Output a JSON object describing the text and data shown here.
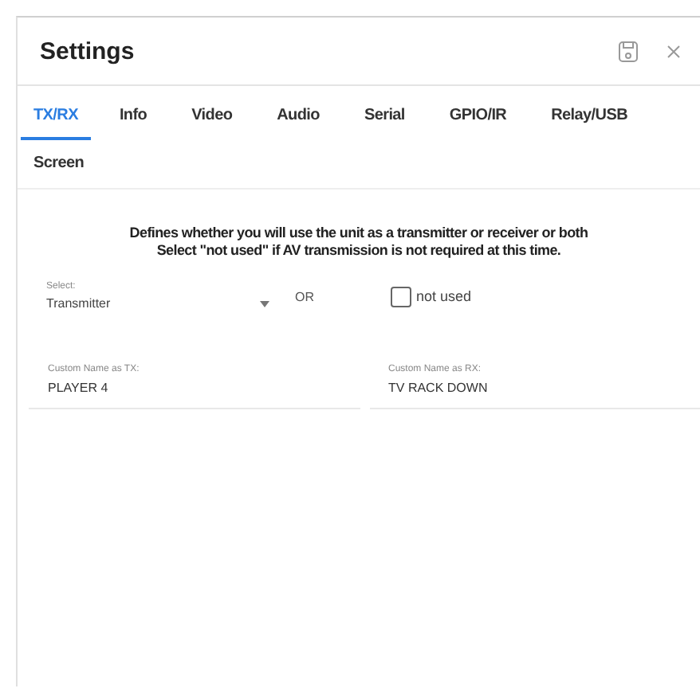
{
  "window": {
    "title": "Settings"
  },
  "tabs": [
    {
      "label": "TX/RX",
      "selected": true
    },
    {
      "label": "Info",
      "selected": false
    },
    {
      "label": "Video",
      "selected": false
    },
    {
      "label": "Audio",
      "selected": false
    },
    {
      "label": "Serial",
      "selected": false
    },
    {
      "label": "GPIO/IR",
      "selected": false
    },
    {
      "label": "Relay/USB",
      "selected": false
    },
    {
      "label": "Screen",
      "selected": false
    }
  ],
  "description": [
    "Defines whether you will use the unit as a transmitter or receiver or both",
    "Select \"not used\" if AV transmission is not required at this time."
  ],
  "select": {
    "label": "Select:",
    "value": "Transmitter"
  },
  "or_label": "OR",
  "not_used": {
    "label": "not used",
    "checked": false
  },
  "fields": [
    {
      "label": "Custom Name as TX:",
      "value": "PLAYER 4"
    },
    {
      "label": "Custom Name as RX:",
      "value": "TV RACK DOWN"
    }
  ]
}
